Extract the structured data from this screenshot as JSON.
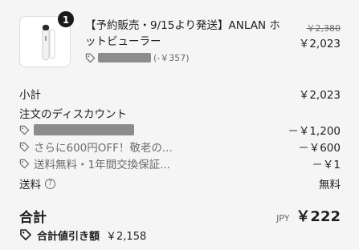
{
  "product": {
    "quantity": "1",
    "title": "【予約販売・9/15より発送】ANLAN ホットビューラー",
    "discount_amount": "(-￥357)",
    "original_price": "￥2,380",
    "price": "￥2,023",
    "icon": "eyelash-curler-product-image"
  },
  "summary": {
    "subtotal_label": "小計",
    "subtotal_value": "￥2,023",
    "order_discount_label": "注文のディスカウント",
    "discounts": [
      {
        "name": "",
        "value": "－￥1,200"
      },
      {
        "name": "さらに600円OFF！敬老の...",
        "value": "－￥600"
      },
      {
        "name": "送料無料・1年間交換保証...",
        "value": "－￥1"
      }
    ],
    "shipping_label": "送料",
    "shipping_value": "無料",
    "total_label": "合計",
    "currency": "JPY",
    "total_value": "￥222",
    "savings_label": "合計値引き額",
    "savings_value": "￥2,158"
  },
  "colors": {
    "background": "#f5f5f5",
    "text": "#1f1f1f",
    "muted": "#6b6b6b",
    "badge": "#1a1a1a",
    "redacted": "#8c8c8c"
  }
}
